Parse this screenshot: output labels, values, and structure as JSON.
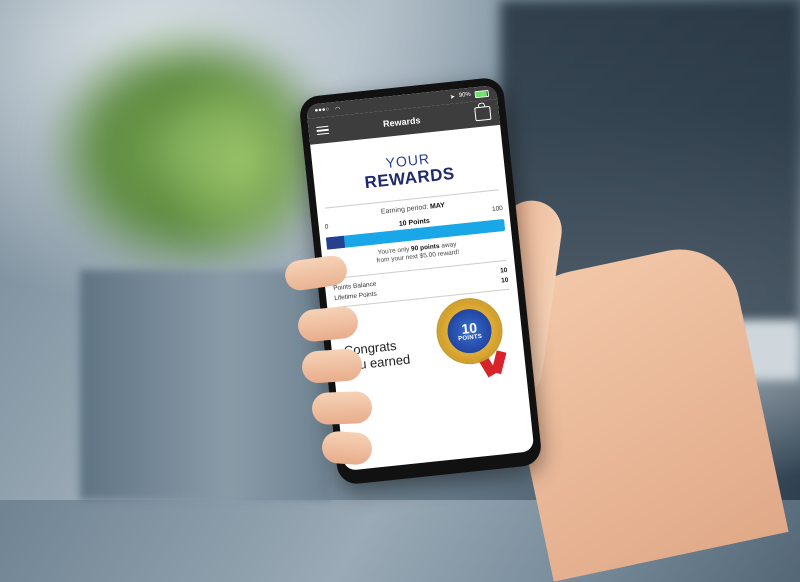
{
  "status": {
    "battery": "90%"
  },
  "app_bar": {
    "title": "Rewards"
  },
  "header": {
    "line1": "YOUR",
    "line2": "REWARDS"
  },
  "earning": {
    "label": "Earning period:",
    "month": "MAY",
    "scale_min": "0",
    "scale_max": "100",
    "points_label": "10 Points",
    "progress_fraction": 0.1,
    "away_prefix": "You're only",
    "away_points": "90 points",
    "away_suffix": "away",
    "away_line2": "from your next $5.00 reward!"
  },
  "stats": [
    {
      "label": "Points Balance",
      "value": "10"
    },
    {
      "label": "Lifetime Points",
      "value": "10"
    }
  ],
  "congrats": {
    "line1": "Congrats",
    "line2": "you earned",
    "medal_number": "10",
    "medal_word": "POINTS"
  },
  "colors": {
    "brand_navy": "#1f2a6b",
    "progress_track": "#1aa7e8",
    "progress_fill": "#263f8f",
    "app_bar": "#3d3d3d"
  }
}
